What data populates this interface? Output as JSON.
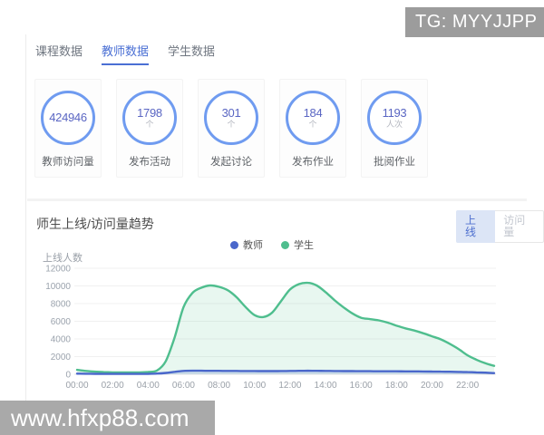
{
  "watermarks": {
    "top_right": "TG: MYYJJPP",
    "bottom_left": "www.hfxp88.com"
  },
  "tabs": [
    {
      "label": "课程数据",
      "active": false
    },
    {
      "label": "教师数据",
      "active": true
    },
    {
      "label": "学生数据",
      "active": false
    }
  ],
  "stats": [
    {
      "value": "424946",
      "unit": "",
      "label": "教师访问量"
    },
    {
      "value": "1798",
      "unit": "个",
      "label": "发布活动"
    },
    {
      "value": "301",
      "unit": "个",
      "label": "发起讨论"
    },
    {
      "value": "184",
      "unit": "个",
      "label": "发布作业"
    },
    {
      "value": "1193",
      "unit": "人次",
      "label": "批阅作业"
    }
  ],
  "trend_section": {
    "title": "师生上线/访问量趋势",
    "toggle": [
      {
        "label": "上线",
        "active": true
      },
      {
        "label": "访问量",
        "active": false
      }
    ],
    "y_axis_label": "上线人数"
  },
  "colors": {
    "accent_blue": "#4a6fd4",
    "stat_circle_border": "#6f9bf0",
    "stat_number": "#5a66c3",
    "teacher_line": "#4a67cb",
    "student_line": "#4fbe8e",
    "toggle_active_bg": "#dce5f6",
    "watermark_gray": "#9c9c9c",
    "grid_line": "#f0f0f0",
    "axis_text": "#9ba3ad"
  },
  "chart_data": {
    "type": "area",
    "title": "师生上线/访问量趋势",
    "xlabel": "",
    "ylabel": "上线人数",
    "ylim": [
      0,
      12000
    ],
    "ytick_step": 2000,
    "grid": true,
    "legend_position": "top",
    "x_unit": "hour",
    "x_domain": [
      0,
      23.5
    ],
    "x_tick_hours": [
      0,
      2,
      4,
      6,
      8,
      10,
      12,
      14,
      16,
      18,
      20,
      22
    ],
    "x_tick_labels": [
      "00:00",
      "02:00",
      "04:00",
      "06:00",
      "08:00",
      "10:00",
      "12:00",
      "14:00",
      "16:00",
      "18:00",
      "20:00",
      "22:00"
    ],
    "x": [
      0,
      0.5,
      1,
      1.5,
      2,
      2.5,
      3,
      3.5,
      4,
      4.5,
      5,
      5.5,
      6,
      6.5,
      7,
      7.5,
      8,
      8.5,
      9,
      9.5,
      10,
      10.5,
      11,
      11.5,
      12,
      12.5,
      13,
      13.5,
      14,
      14.5,
      15,
      15.5,
      16,
      16.5,
      17,
      17.5,
      18,
      18.5,
      19,
      19.5,
      20,
      20.5,
      21,
      21.5,
      22,
      22.5,
      23,
      23.5
    ],
    "series": [
      {
        "name": "教师",
        "color": "#4a67cb",
        "fill_opacity": 0.16,
        "values": [
          70,
          60,
          50,
          45,
          40,
          40,
          40,
          45,
          55,
          80,
          150,
          280,
          380,
          400,
          395,
          390,
          385,
          380,
          375,
          370,
          365,
          360,
          360,
          365,
          375,
          385,
          395,
          390,
          380,
          370,
          360,
          355,
          350,
          345,
          340,
          335,
          335,
          330,
          325,
          320,
          310,
          300,
          285,
          270,
          250,
          220,
          180,
          130
        ]
      },
      {
        "name": "学生",
        "color": "#4fbe8e",
        "fill_opacity": 0.13,
        "values": [
          500,
          380,
          300,
          250,
          220,
          210,
          200,
          210,
          260,
          420,
          1500,
          4200,
          7600,
          9200,
          9800,
          10050,
          9900,
          9500,
          8700,
          7600,
          6700,
          6480,
          7000,
          8300,
          9600,
          10200,
          10350,
          10050,
          9300,
          8400,
          7600,
          6900,
          6400,
          6250,
          6100,
          5850,
          5500,
          5200,
          4950,
          4650,
          4300,
          3950,
          3450,
          2850,
          2150,
          1650,
          1250,
          950
        ]
      }
    ]
  }
}
